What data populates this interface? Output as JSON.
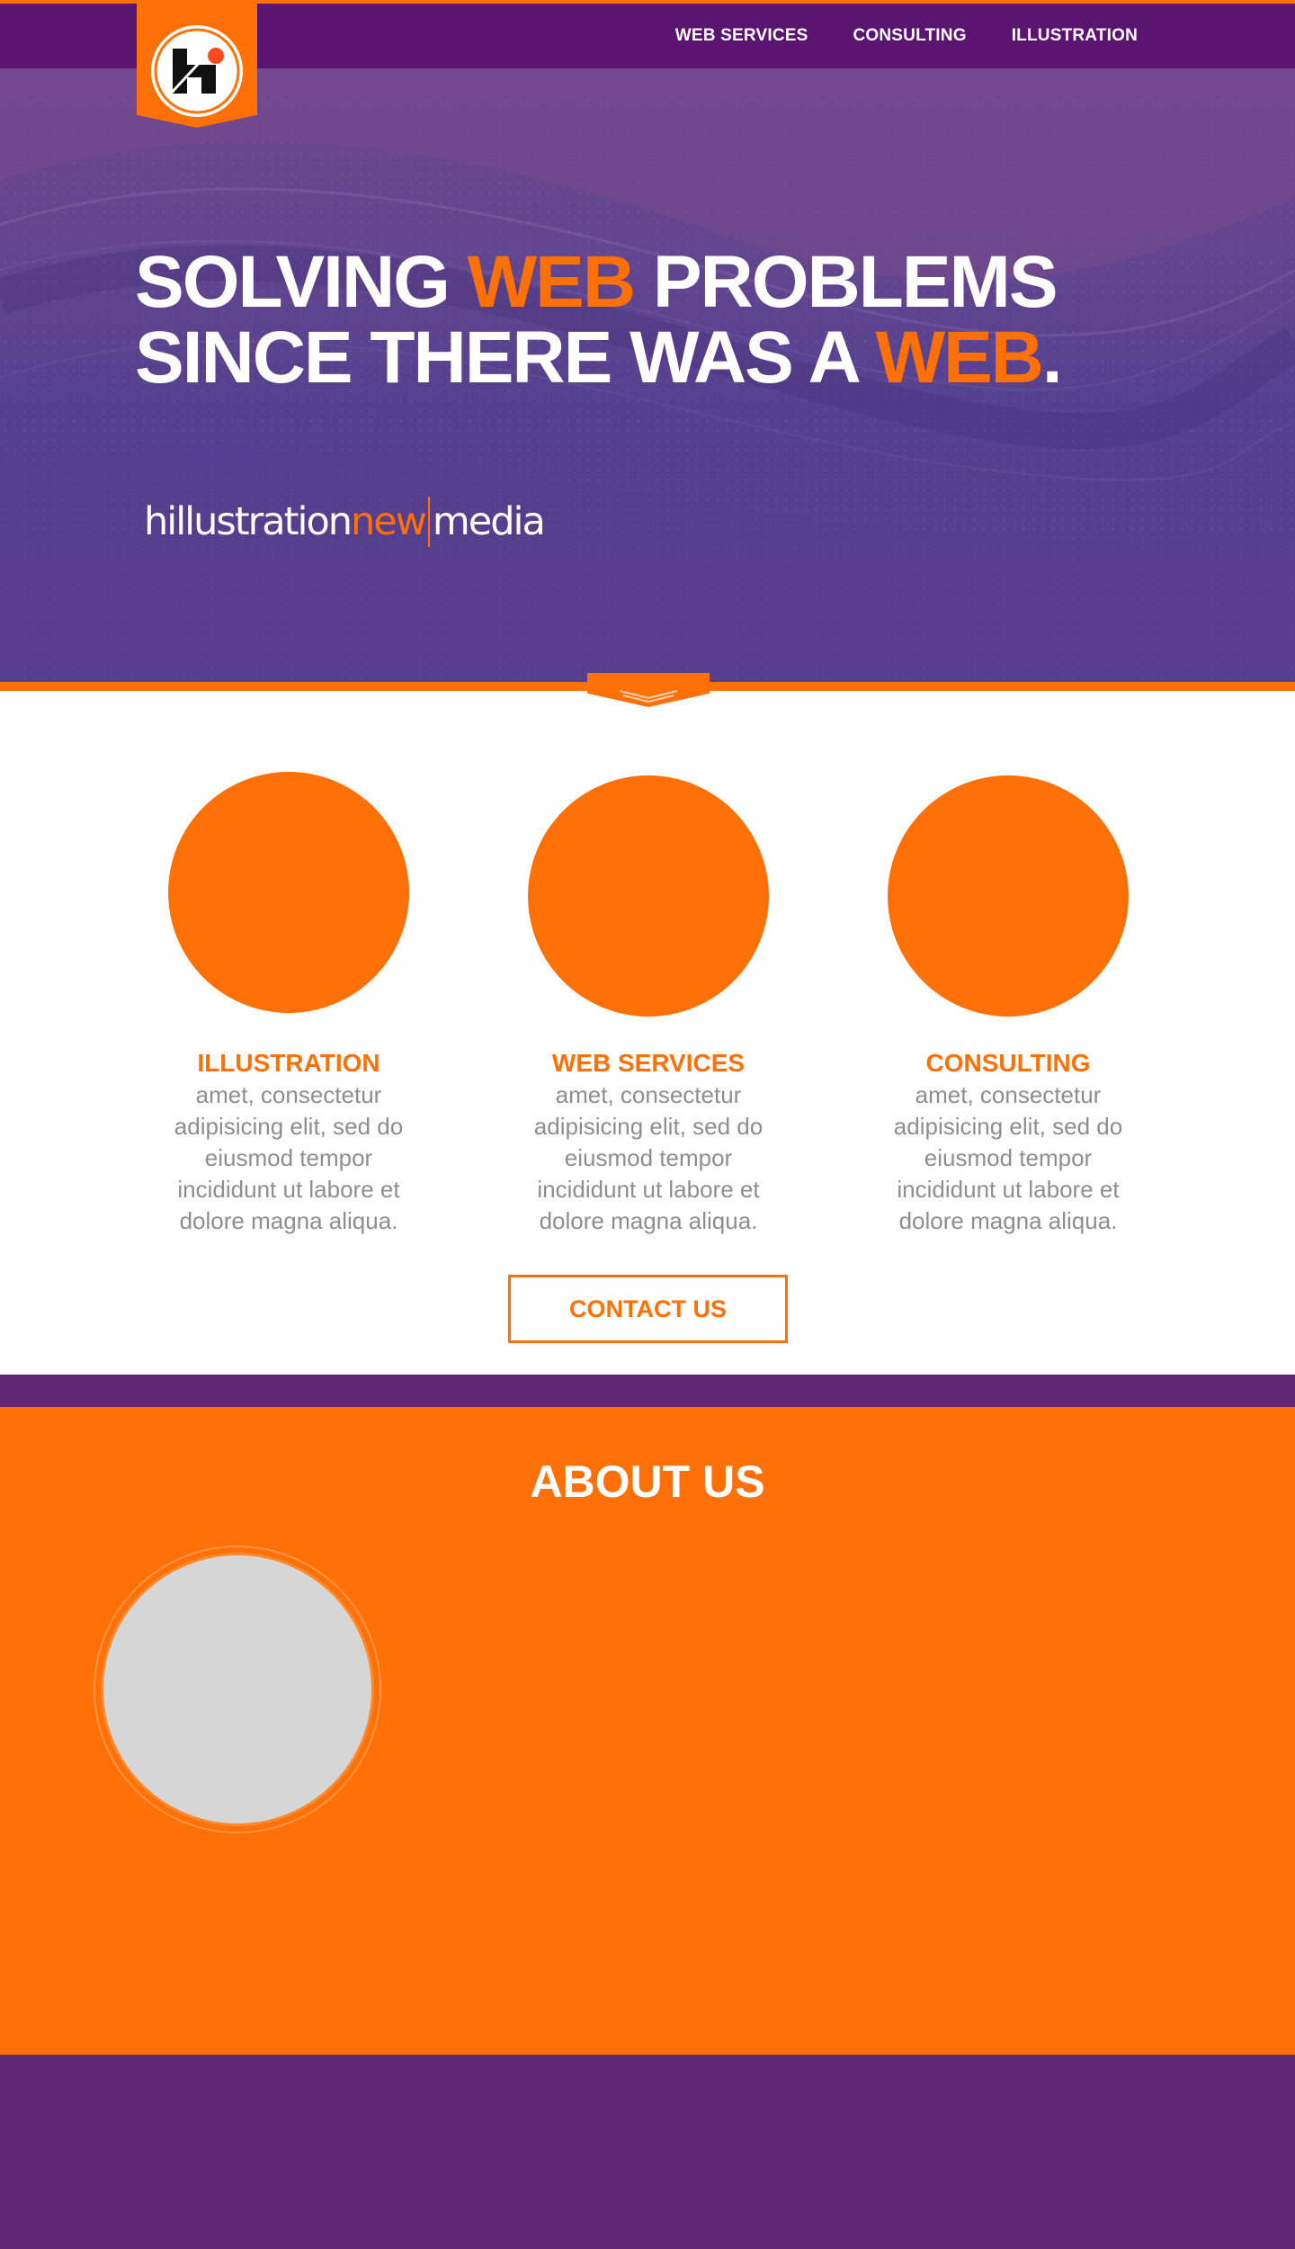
{
  "colors": {
    "accent": "#ff7006",
    "purple_dark": "#5a1570",
    "purple_band": "#5f2673",
    "hero_purple": "#63468f",
    "white": "#ffffff",
    "body_text": "#8e8e8e",
    "avatar_placeholder": "#d6d6d6"
  },
  "nav": {
    "items": [
      {
        "label": "WEB SERVICES"
      },
      {
        "label": "CONSULTING"
      },
      {
        "label": "ILLUSTRATION"
      }
    ]
  },
  "logo": {
    "icon": "h-monogram-icon"
  },
  "hero": {
    "line1_a": "SOLVING ",
    "line1_accent": "WEB",
    "line1_b": " PROBLEMS",
    "line2_a": "SINCE THERE WAS A ",
    "line2_accent": "WEB",
    "line2_b": ".",
    "brand_part1": "hillustration",
    "brand_part2": "new",
    "brand_part3": "media",
    "scroll_icon": "chevron-down-icon"
  },
  "services": [
    {
      "title": "ILLUSTRATION",
      "lines": [
        "amet, consectetur",
        "adipisicing elit, sed do",
        "eiusmod tempor",
        "incididunt ut labore et",
        "dolore magna aliqua."
      ]
    },
    {
      "title": "WEB SERVICES",
      "lines": [
        "amet, consectetur",
        "adipisicing elit, sed do",
        "eiusmod tempor",
        "incididunt ut labore et",
        "dolore magna aliqua."
      ]
    },
    {
      "title": "CONSULTING",
      "lines": [
        "amet, consectetur",
        "adipisicing elit, sed do",
        "eiusmod tempor",
        "incididunt ut labore et",
        "dolore magna aliqua."
      ]
    }
  ],
  "contact_button": {
    "label": "CONTACT US"
  },
  "about": {
    "title": "ABOUT US"
  }
}
